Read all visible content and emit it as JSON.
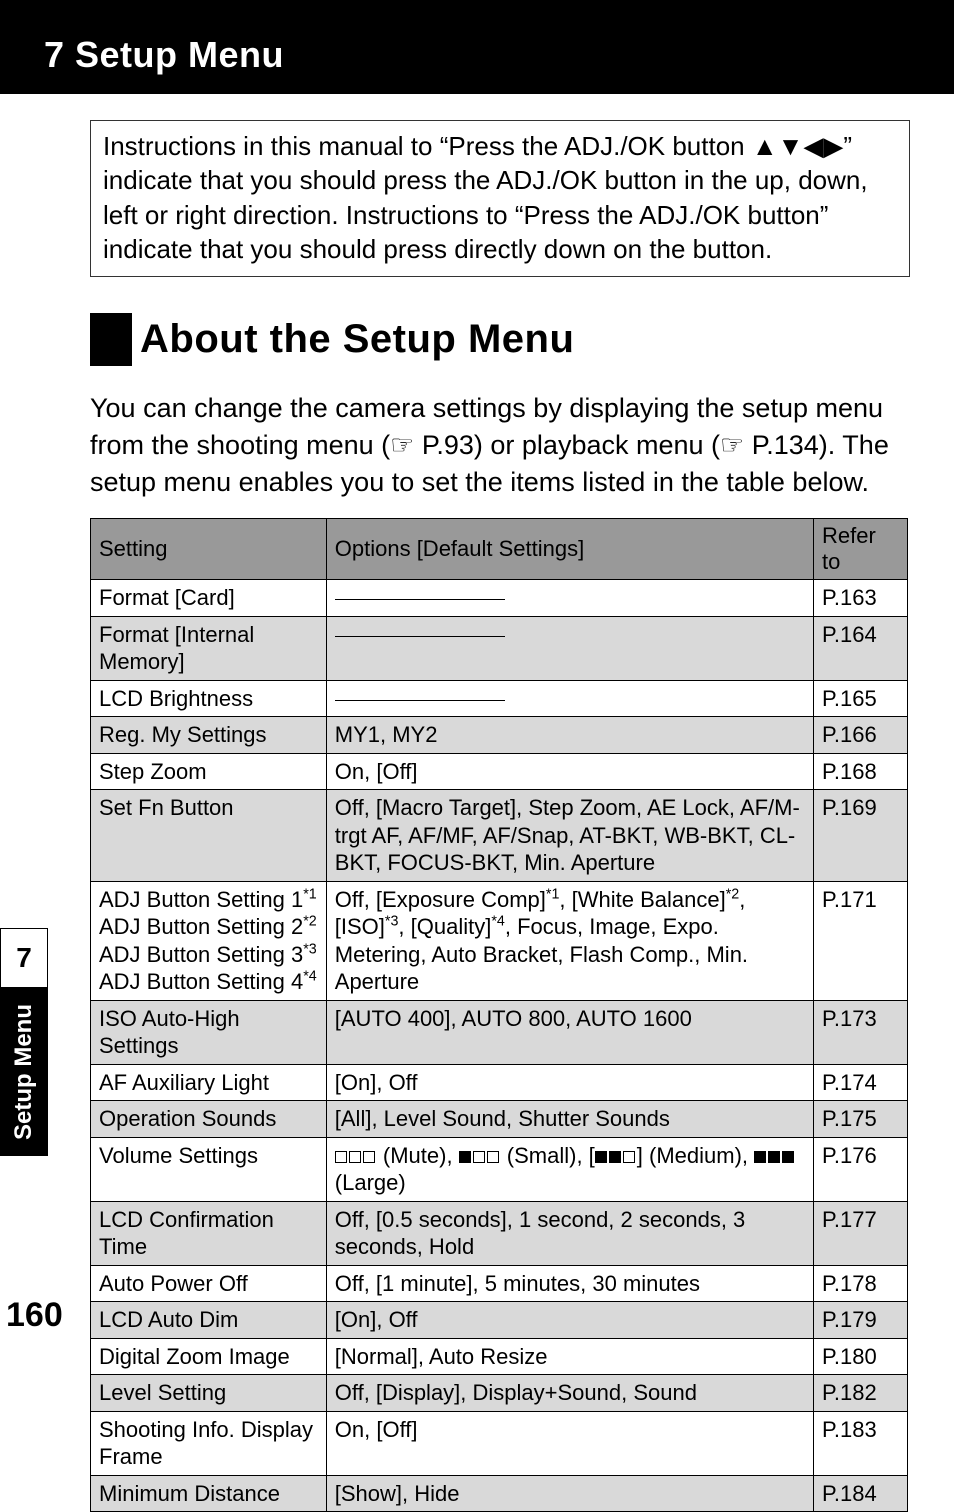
{
  "chapter_header": "7  Setup Menu",
  "intro": "Instructions in this manual to “Press the ADJ./OK button ▲▼◀▶” indicate that you should press the ADJ./OK button in the up, down, left or right direction. Instructions to “Press the ADJ./OK button” indicate that you should press directly down on the button.",
  "section_title": "About the Setup Menu",
  "body": "You can change the camera settings by displaying the setup menu from the shooting menu (☞ P.93) or playback menu (☞ P.134). The setup menu enables you to set the items listed in the table below.",
  "table": {
    "headers": {
      "setting": "Setting",
      "options": "Options [Default Settings]",
      "ref": "Refer to"
    },
    "rows": [
      {
        "setting": "Format [Card]",
        "options": "__DASH__",
        "ref": "P.163",
        "shade": false
      },
      {
        "setting": "Format [Internal Memory]",
        "options": "__DASH__",
        "ref": "P.164",
        "shade": true
      },
      {
        "setting": "LCD Brightness",
        "options": "__DASH__",
        "ref": "P.165",
        "shade": false
      },
      {
        "setting": "Reg. My Settings",
        "options": "MY1, MY2",
        "ref": "P.166",
        "shade": true
      },
      {
        "setting": "Step Zoom",
        "options": "On, [Off]",
        "ref": "P.168",
        "shade": false
      },
      {
        "setting": "Set Fn Button",
        "options": "Off, [Macro Target], Step Zoom, AE Lock, AF/M-trgt AF, AF/MF, AF/Snap, AT-BKT, WB-BKT, CL-BKT, FOCUS-BKT, Min. Aperture",
        "ref": "P.169",
        "shade": true
      },
      {
        "setting": "__ADJBTN__",
        "options": "__ADJOPT__",
        "ref": "P.171",
        "shade": false
      },
      {
        "setting": "ISO Auto-High Settings",
        "options": "[AUTO 400], AUTO 800, AUTO 1600",
        "ref": "P.173",
        "shade": true
      },
      {
        "setting": "AF Auxiliary Light",
        "options": "[On], Off",
        "ref": "P.174",
        "shade": false
      },
      {
        "setting": "Operation Sounds",
        "options": "[All], Level Sound, Shutter Sounds",
        "ref": "P.175",
        "shade": true
      },
      {
        "setting": "Volume Settings",
        "options": "__VOLUME__",
        "ref": "P.176",
        "shade": false
      },
      {
        "setting": "LCD Confirmation Time",
        "options": "Off, [0.5 seconds], 1 second, 2 seconds, 3 seconds, Hold",
        "ref": "P.177",
        "shade": true
      },
      {
        "setting": "Auto Power Off",
        "options": "Off, [1 minute], 5 minutes, 30 minutes",
        "ref": "P.178",
        "shade": false
      },
      {
        "setting": "LCD Auto Dim",
        "options": "[On], Off",
        "ref": "P.179",
        "shade": true
      },
      {
        "setting": "Digital Zoom Image",
        "options": "[Normal], Auto Resize",
        "ref": "P.180",
        "shade": false
      },
      {
        "setting": "Level Setting",
        "options": "Off, [Display], Display+Sound, Sound",
        "ref": "P.182",
        "shade": true
      },
      {
        "setting": "Shooting Info. Display Frame",
        "options": "On, [Off]",
        "ref": "P.183",
        "shade": false
      },
      {
        "setting": "Minimum Distance",
        "options": "[Show], Hide",
        "ref": "P.184",
        "shade": true
      }
    ]
  },
  "adj_btn_lines": [
    "ADJ Button Setting 1",
    "ADJ Button Setting 2",
    "ADJ Button Setting 3",
    "ADJ Button Setting 4"
  ],
  "adj_btn_sups": [
    "*1",
    "*2",
    "*3",
    "*4"
  ],
  "adj_opt_parts": {
    "p1": "Off, [Exposure Comp]",
    "s1": "*1",
    "p2": ", [White Balance]",
    "s2": "*2",
    "p3": ", [ISO]",
    "s3": "*3",
    "p4": ", [Quality]",
    "s4": "*4",
    "p5": ", Focus, Image, Expo. Metering, Auto Bracket, Flash Comp., Min. Aperture"
  },
  "volume_parts": {
    "mute": " (Mute), ",
    "small": " (Small), [",
    "medium": "] (Medium), ",
    "large": " (Large)"
  },
  "side": {
    "num": "7",
    "label": "Setup Menu"
  },
  "page_number": "160"
}
